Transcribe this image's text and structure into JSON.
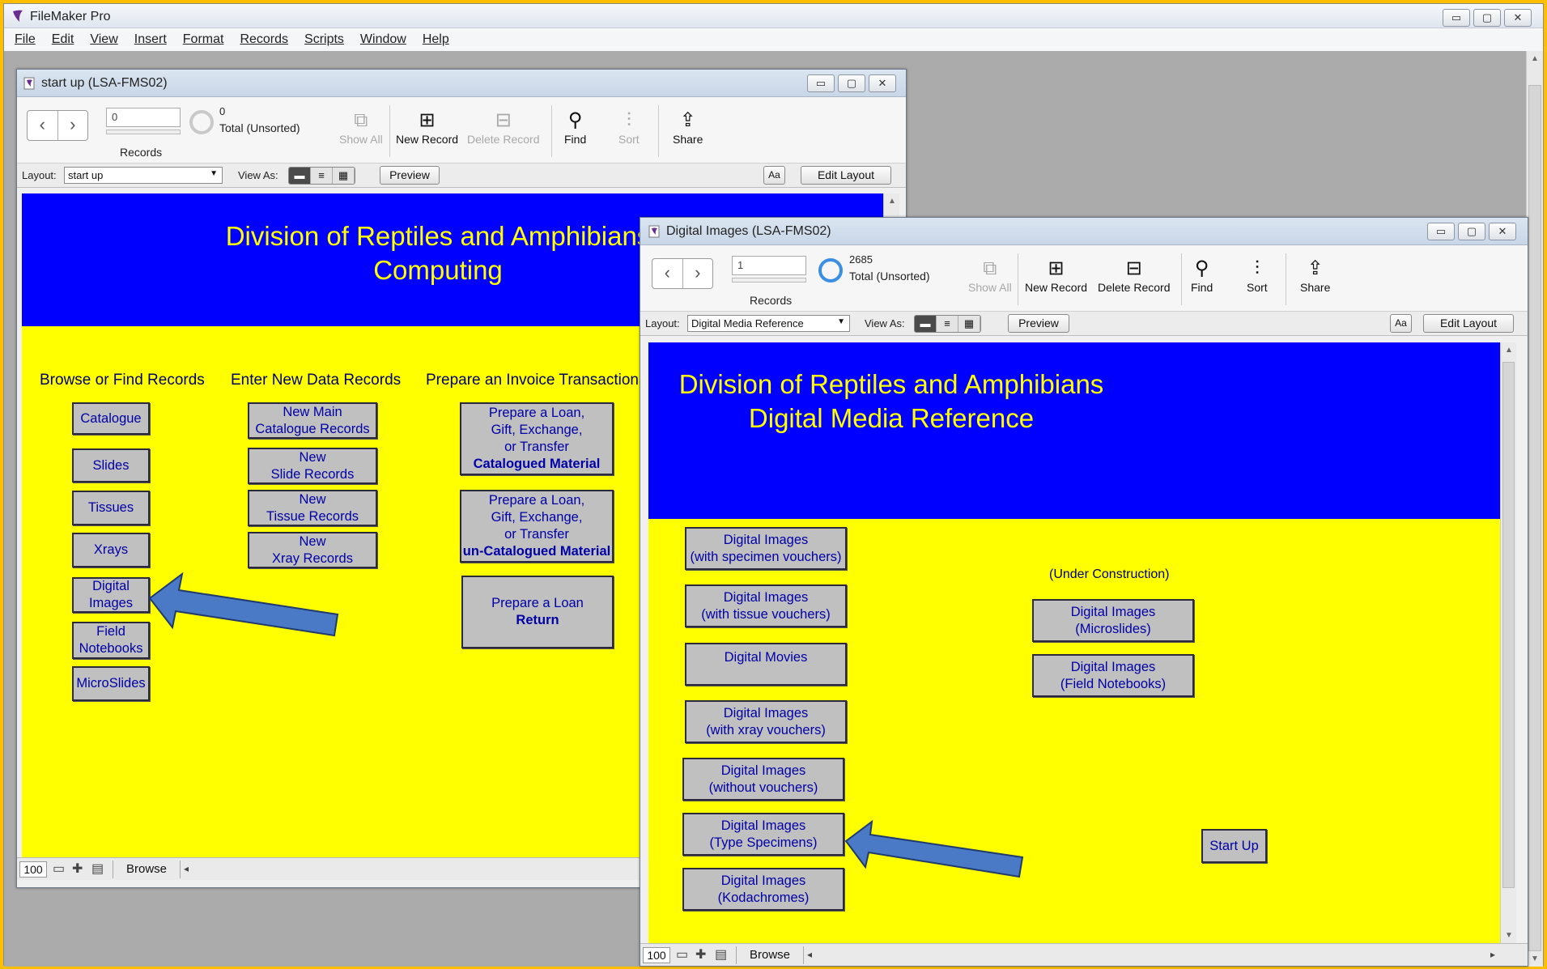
{
  "app": {
    "title": "FileMaker Pro",
    "window_controls": [
      "▭",
      "▢",
      "✕"
    ],
    "menu": [
      "File",
      "Edit",
      "View",
      "Insert",
      "Format",
      "Records",
      "Scripts",
      "Window",
      "Help"
    ]
  },
  "win1": {
    "title": "start up (LSA-FMS02)",
    "record_input": "0",
    "records_label": "Records",
    "found_count": "0",
    "total_label": "Total (Unsorted)",
    "toolbar": {
      "show_all": "Show All",
      "new_record": "New Record",
      "delete_record": "Delete Record",
      "find": "Find",
      "sort": "Sort",
      "share": "Share"
    },
    "layout_label": "Layout:",
    "layout_value": "start up",
    "view_as_label": "View As:",
    "preview": "Preview",
    "edit_layout": "Edit Layout",
    "header_line1": "Division of Reptiles and Amphibians",
    "header_line2": "Computing",
    "col_browse": "Browse or Find Records",
    "col_enter": "Enter New Data Records",
    "col_invoice": "Prepare an Invoice Transaction",
    "browse_buttons": [
      "Catalogue",
      "Slides",
      "Tissues",
      "Xrays",
      "Digital Images",
      "Field Notebooks",
      "MicroSlides"
    ],
    "enter_buttons": [
      {
        "line1": "New Main",
        "line2": "Catalogue Records"
      },
      {
        "line1": "New",
        "line2": "Slide Records"
      },
      {
        "line1": "New",
        "line2": "Tissue Records"
      },
      {
        "line1": "New",
        "line2": "Xray Records"
      }
    ],
    "invoice1": {
      "l1": "Prepare a Loan,",
      "l2": "Gift, Exchange,",
      "l3": "or Transfer",
      "bold": "Catalogued Material"
    },
    "invoice2": {
      "l1": "Prepare a Loan,",
      "l2": "Gift, Exchange,",
      "l3": "or Transfer",
      "bold": "un-Catalogued Material"
    },
    "invoice3": {
      "l1": "Prepare a Loan",
      "bold": "Return"
    },
    "zoom": "100",
    "mode": "Browse"
  },
  "win2": {
    "title": "Digital Images (LSA-FMS02)",
    "record_input": "1",
    "records_label": "Records",
    "found_count": "2685",
    "total_label": "Total (Unsorted)",
    "toolbar": {
      "show_all": "Show All",
      "new_record": "New Record",
      "delete_record": "Delete Record",
      "find": "Find",
      "sort": "Sort",
      "share": "Share"
    },
    "layout_label": "Layout:",
    "layout_value": "Digital Media Reference",
    "view_as_label": "View As:",
    "preview": "Preview",
    "edit_layout": "Edit Layout",
    "header_line1": "Division of Reptiles and Amphibians",
    "header_line2": "Digital Media Reference",
    "left_buttons": [
      {
        "l1": "Digital Images",
        "l2": "(with specimen vouchers)"
      },
      {
        "l1": "Digital Images",
        "l2": "(with tissue vouchers)"
      },
      {
        "l1": "Digital Movies",
        "l2": ""
      },
      {
        "l1": "Digital Images",
        "l2": "(with xray vouchers)"
      },
      {
        "l1": "Digital Images",
        "l2": "(without vouchers)"
      },
      {
        "l1": "Digital Images",
        "l2": "(Type Specimens)"
      },
      {
        "l1": "Digital Images",
        "l2": "(Kodachromes)"
      }
    ],
    "under_construction": "(Under Construction)",
    "right_buttons": [
      {
        "l1": "Digital Images",
        "l2": "(Microslides)"
      },
      {
        "l1": "Digital Images",
        "l2": "(Field Notebooks)"
      }
    ],
    "start_up": "Start Up",
    "zoom": "100",
    "mode": "Browse"
  },
  "colors": {
    "header_blue": "#0000ff",
    "body_yellow": "#ffff00",
    "button_gray": "#c0c0c0",
    "button_text": "#0000a8",
    "arrow_blue": "#4a79c6"
  }
}
